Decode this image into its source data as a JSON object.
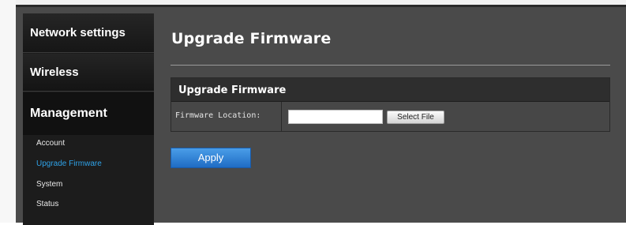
{
  "sidebar": {
    "sections": {
      "network": "Network settings",
      "wireless": "Wireless",
      "management": "Management"
    },
    "management_items": [
      "Account",
      "Upgrade Firmware",
      "System",
      "Status"
    ],
    "active_item": "Upgrade Firmware"
  },
  "main": {
    "title": "Upgrade Firmware",
    "table": {
      "header": "Upgrade Firmware",
      "rows": [
        {
          "label": "Firmware Location:",
          "input_value": "",
          "button_label": "Select File"
        }
      ]
    },
    "apply_label": "Apply"
  },
  "colors": {
    "panel_bg": "#4a4a4a",
    "sidebar_bg": "#1c1c1c",
    "active_link": "#2fa2e8",
    "apply_button": "#2f82d6"
  }
}
